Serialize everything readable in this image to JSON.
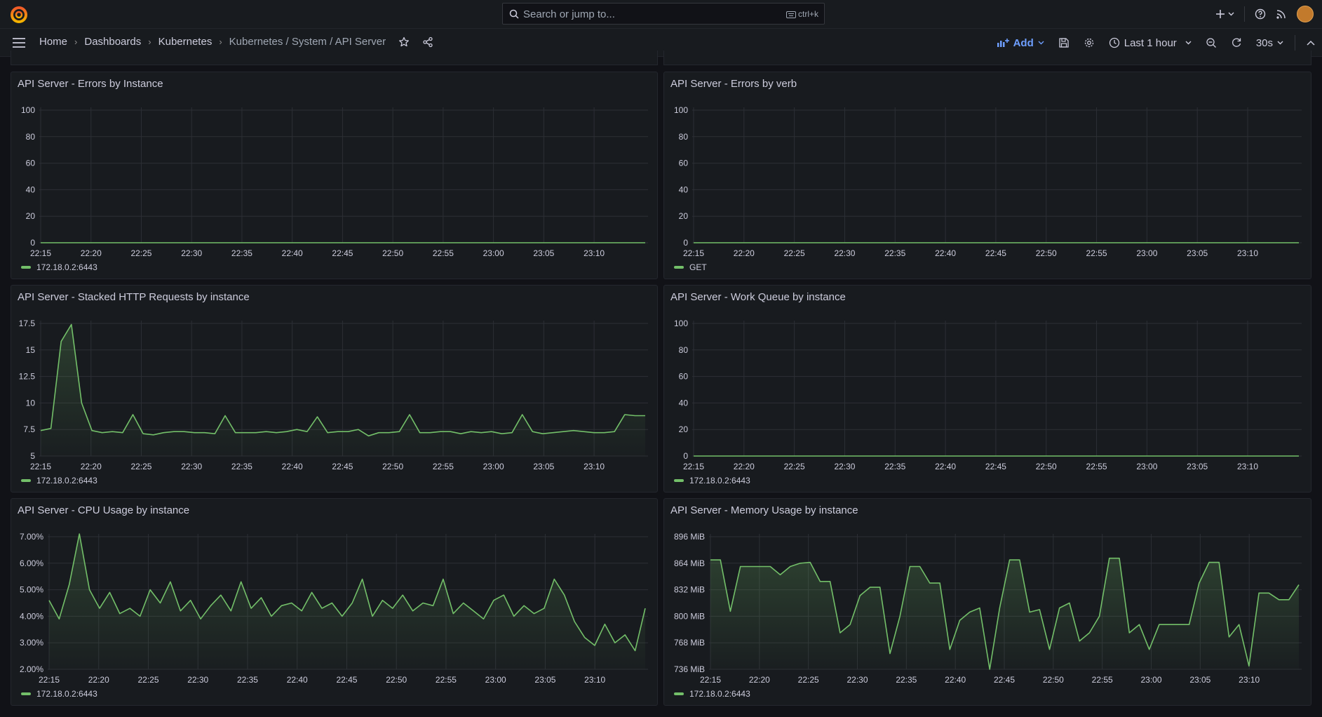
{
  "topbar": {
    "search_placeholder": "Search or jump to...",
    "search_shortcut": "ctrl+k",
    "icons": [
      "grafana-logo-icon",
      "search-icon",
      "keyboard-icon",
      "plus-icon",
      "help-icon",
      "rss-icon",
      "avatar"
    ]
  },
  "breadcrumbs": [
    "Home",
    "Dashboards",
    "Kubernetes",
    "Kubernetes / System / API Server"
  ],
  "toolbar": {
    "add_label": "Add",
    "time_range": "Last 1 hour",
    "refresh_interval": "30s"
  },
  "colors": {
    "series": "#73bf69",
    "accent": "#6e9fff",
    "panel_bg": "#181b1f",
    "page_bg": "#111217"
  },
  "panels": [
    {
      "title": "API Server - Errors by Instance",
      "legend": "172.18.0.2:6443",
      "yticks": [
        "100",
        "80",
        "60",
        "40",
        "20",
        "0"
      ],
      "xticks": [
        "22:15",
        "22:20",
        "22:25",
        "22:30",
        "22:35",
        "22:40",
        "22:45",
        "22:50",
        "22:55",
        "23:00",
        "23:05",
        "23:10"
      ]
    },
    {
      "title": "API Server - Errors by verb",
      "legend": "GET",
      "yticks": [
        "100",
        "80",
        "60",
        "40",
        "20",
        "0"
      ],
      "xticks": [
        "22:15",
        "22:20",
        "22:25",
        "22:30",
        "22:35",
        "22:40",
        "22:45",
        "22:50",
        "22:55",
        "23:00",
        "23:05",
        "23:10"
      ]
    },
    {
      "title": "API Server - Stacked HTTP Requests by instance",
      "legend": "172.18.0.2:6443",
      "yticks": [
        "17.5",
        "15",
        "12.5",
        "10",
        "7.5",
        "5"
      ],
      "xticks": [
        "22:15",
        "22:20",
        "22:25",
        "22:30",
        "22:35",
        "22:40",
        "22:45",
        "22:50",
        "22:55",
        "23:00",
        "23:05",
        "23:10"
      ]
    },
    {
      "title": "API Server - Work Queue by instance",
      "legend": "172.18.0.2:6443",
      "yticks": [
        "100",
        "80",
        "60",
        "40",
        "20",
        "0"
      ],
      "xticks": [
        "22:15",
        "22:20",
        "22:25",
        "22:30",
        "22:35",
        "22:40",
        "22:45",
        "22:50",
        "22:55",
        "23:00",
        "23:05",
        "23:10"
      ]
    },
    {
      "title": "API Server - CPU Usage by instance",
      "legend": "172.18.0.2:6443",
      "yticks": [
        "7.00%",
        "6.00%",
        "5.00%",
        "4.00%",
        "3.00%",
        "2.00%"
      ],
      "xticks": [
        "22:15",
        "22:20",
        "22:25",
        "22:30",
        "22:35",
        "22:40",
        "22:45",
        "22:50",
        "22:55",
        "23:00",
        "23:05",
        "23:10"
      ]
    },
    {
      "title": "API Server - Memory Usage by instance",
      "legend": "172.18.0.2:6443",
      "yticks": [
        "896 MiB",
        "864 MiB",
        "832 MiB",
        "800 MiB",
        "768 MiB",
        "736 MiB"
      ],
      "xticks": [
        "22:15",
        "22:20",
        "22:25",
        "22:30",
        "22:35",
        "22:40",
        "22:45",
        "22:50",
        "22:55",
        "23:00",
        "23:05",
        "23:10"
      ]
    }
  ],
  "chart_data": [
    {
      "type": "line",
      "title": "API Server - Errors by Instance",
      "x": [
        "22:15",
        "22:20",
        "22:25",
        "22:30",
        "22:35",
        "22:40",
        "22:45",
        "22:50",
        "22:55",
        "23:00",
        "23:05",
        "23:10"
      ],
      "ylim": [
        0,
        100
      ],
      "grid": true,
      "legend_position": "bottom",
      "series": [
        {
          "name": "172.18.0.2:6443",
          "values": [
            0,
            0,
            0,
            0,
            0,
            0,
            0,
            0,
            0,
            0,
            0,
            0,
            0
          ]
        }
      ]
    },
    {
      "type": "line",
      "title": "API Server - Errors by verb",
      "x": [
        "22:15",
        "22:20",
        "22:25",
        "22:30",
        "22:35",
        "22:40",
        "22:45",
        "22:50",
        "22:55",
        "23:00",
        "23:05",
        "23:10"
      ],
      "ylim": [
        0,
        100
      ],
      "grid": true,
      "legend_position": "bottom",
      "series": [
        {
          "name": "GET",
          "values": [
            0,
            0,
            0,
            0,
            0,
            0,
            0,
            0,
            0,
            0,
            0,
            0,
            0
          ]
        }
      ]
    },
    {
      "type": "area",
      "title": "API Server - Stacked HTTP Requests by instance",
      "x": [
        "22:15",
        "22:16",
        "22:17",
        "22:18",
        "22:19",
        "22:20",
        "22:21",
        "22:22",
        "22:23",
        "22:24",
        "22:25",
        "22:26",
        "22:27",
        "22:28",
        "22:29",
        "22:30",
        "22:31",
        "22:32",
        "22:33",
        "22:34",
        "22:35",
        "22:36",
        "22:37",
        "22:38",
        "22:39",
        "22:40",
        "22:41",
        "22:42",
        "22:43",
        "22:44",
        "22:45",
        "22:46",
        "22:47",
        "22:48",
        "22:49",
        "22:50",
        "22:51",
        "22:52",
        "22:53",
        "22:54",
        "22:55",
        "22:56",
        "22:57",
        "22:58",
        "22:59",
        "23:00",
        "23:01",
        "23:02",
        "23:03",
        "23:04",
        "23:05",
        "23:06",
        "23:07",
        "23:08",
        "23:09",
        "23:10",
        "23:11",
        "23:12",
        "23:13",
        "23:14"
      ],
      "ylim": [
        5,
        18.5
      ],
      "grid": true,
      "legend_position": "bottom",
      "series": [
        {
          "name": "172.18.0.2:6443",
          "values": [
            7.4,
            7.6,
            15.8,
            17.4,
            10,
            7.4,
            7.2,
            7.3,
            7.2,
            8.9,
            7.1,
            7.0,
            7.2,
            7.3,
            7.3,
            7.2,
            7.2,
            7.1,
            8.8,
            7.2,
            7.2,
            7.2,
            7.3,
            7.2,
            7.3,
            7.5,
            7.3,
            8.7,
            7.2,
            7.3,
            7.3,
            7.5,
            6.9,
            7.2,
            7.2,
            7.3,
            8.9,
            7.2,
            7.2,
            7.3,
            7.3,
            7.1,
            7.3,
            7.2,
            7.3,
            7.1,
            7.2,
            8.9,
            7.3,
            7.1,
            7.2,
            7.3,
            7.4,
            7.3,
            7.2,
            7.2,
            7.3,
            8.9,
            8.8,
            8.8
          ]
        }
      ]
    },
    {
      "type": "line",
      "title": "API Server - Work Queue by instance",
      "x": [
        "22:15",
        "22:20",
        "22:25",
        "22:30",
        "22:35",
        "22:40",
        "22:45",
        "22:50",
        "22:55",
        "23:00",
        "23:05",
        "23:10"
      ],
      "ylim": [
        0,
        100
      ],
      "grid": true,
      "legend_position": "bottom",
      "series": [
        {
          "name": "172.18.0.2:6443",
          "values": [
            0,
            0,
            0,
            0,
            0,
            0,
            0,
            0,
            0,
            0,
            0,
            0,
            0
          ]
        }
      ]
    },
    {
      "type": "area",
      "title": "API Server - CPU Usage by instance",
      "x": [
        "22:15",
        "22:16",
        "22:17",
        "22:18",
        "22:19",
        "22:20",
        "22:21",
        "22:22",
        "22:23",
        "22:24",
        "22:25",
        "22:26",
        "22:27",
        "22:28",
        "22:29",
        "22:30",
        "22:31",
        "22:32",
        "22:33",
        "22:34",
        "22:35",
        "22:36",
        "22:37",
        "22:38",
        "22:39",
        "22:40",
        "22:41",
        "22:42",
        "22:43",
        "22:44",
        "22:45",
        "22:46",
        "22:47",
        "22:48",
        "22:49",
        "22:50",
        "22:51",
        "22:52",
        "22:53",
        "22:54",
        "22:55",
        "22:56",
        "22:57",
        "22:58",
        "22:59",
        "23:00",
        "23:01",
        "23:02",
        "23:03",
        "23:04",
        "23:05",
        "23:06",
        "23:07",
        "23:08",
        "23:09",
        "23:10",
        "23:11",
        "23:12",
        "23:13",
        "23:14"
      ],
      "ylim": [
        2,
        7.5
      ],
      "ylabel_unit": "%",
      "grid": true,
      "legend_position": "bottom",
      "series": [
        {
          "name": "172.18.0.2:6443",
          "values": [
            4.6,
            3.9,
            5.2,
            7.2,
            5.0,
            4.3,
            4.9,
            4.1,
            4.3,
            4.0,
            5.0,
            4.5,
            5.3,
            4.2,
            4.6,
            3.9,
            4.4,
            4.8,
            4.2,
            5.3,
            4.3,
            4.7,
            4.0,
            4.4,
            4.5,
            4.2,
            4.9,
            4.3,
            4.5,
            4.0,
            4.5,
            5.4,
            4.0,
            4.6,
            4.3,
            4.8,
            4.2,
            4.5,
            4.4,
            5.4,
            4.1,
            4.5,
            4.2,
            3.9,
            4.6,
            4.8,
            4.0,
            4.4,
            4.1,
            4.3,
            5.4,
            4.8,
            3.8,
            3.2,
            2.9,
            3.7,
            3.0,
            3.3,
            2.7,
            4.3
          ]
        }
      ]
    },
    {
      "type": "area",
      "title": "API Server - Memory Usage by instance",
      "x": [
        "22:15",
        "22:16",
        "22:17",
        "22:18",
        "22:19",
        "22:20",
        "22:21",
        "22:22",
        "22:23",
        "22:24",
        "22:25",
        "22:26",
        "22:27",
        "22:28",
        "22:29",
        "22:30",
        "22:31",
        "22:32",
        "22:33",
        "22:34",
        "22:35",
        "22:36",
        "22:37",
        "22:38",
        "22:39",
        "22:40",
        "22:41",
        "22:42",
        "22:43",
        "22:44",
        "22:45",
        "22:46",
        "22:47",
        "22:48",
        "22:49",
        "22:50",
        "22:51",
        "22:52",
        "22:53",
        "22:54",
        "22:55",
        "22:56",
        "22:57",
        "22:58",
        "22:59",
        "23:00",
        "23:01",
        "23:02",
        "23:03",
        "23:04",
        "23:05",
        "23:06",
        "23:07",
        "23:08",
        "23:09",
        "23:10",
        "23:11",
        "23:12",
        "23:13",
        "23:14"
      ],
      "ylim": [
        720,
        900
      ],
      "ylabel_unit": "MiB",
      "grid": true,
      "legend_position": "bottom",
      "series": [
        {
          "name": "172.18.0.2:6443",
          "values": [
            868,
            868,
            806,
            860,
            860,
            860,
            860,
            850,
            860,
            864,
            865,
            842,
            842,
            780,
            790,
            825,
            835,
            835,
            755,
            800,
            860,
            860,
            840,
            840,
            760,
            795,
            805,
            810,
            735,
            810,
            868,
            868,
            805,
            808,
            760,
            810,
            816,
            770,
            780,
            800,
            870,
            870,
            780,
            790,
            760,
            790,
            790,
            790,
            790,
            840,
            865,
            865,
            775,
            790,
            740,
            828,
            828,
            820,
            820,
            838
          ]
        }
      ]
    }
  ]
}
